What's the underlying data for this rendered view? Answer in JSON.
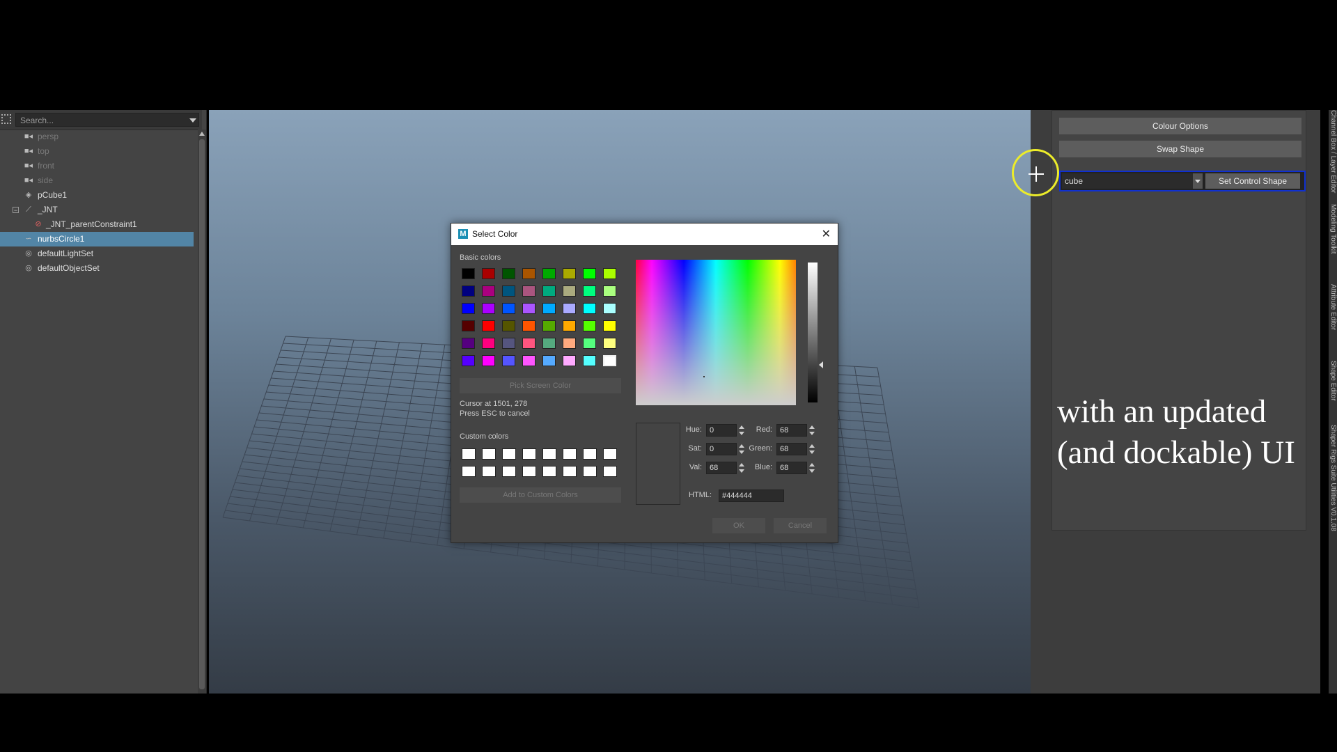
{
  "outliner": {
    "search_placeholder": "Search...",
    "items": [
      {
        "label": "persp",
        "icon": "camera-icon"
      },
      {
        "label": "top",
        "icon": "camera-icon"
      },
      {
        "label": "front",
        "icon": "camera-icon"
      },
      {
        "label": "side",
        "icon": "camera-icon"
      },
      {
        "label": "pCube1",
        "icon": "mesh-icon"
      },
      {
        "label": "_JNT",
        "icon": "joint-icon"
      },
      {
        "label": "_JNT_parentConstraint1",
        "icon": "constraint-icon"
      },
      {
        "label": "nurbsCircle1",
        "icon": "curve-icon"
      },
      {
        "label": "defaultLightSet",
        "icon": "set-icon"
      },
      {
        "label": "defaultObjectSet",
        "icon": "set-icon"
      }
    ]
  },
  "right_panel": {
    "colour_options_label": "Colour Options",
    "swap_shape_label": "Swap Shape",
    "shape_value": "cube",
    "set_control_shape_label": "Set Control Shape",
    "caption_line1": "with an updated",
    "caption_line2": "(and dockable) UI",
    "side_tabs": [
      "Channel Box / Layer Editor",
      "Modeling Toolkit",
      "Attribute Editor",
      "Shape Editor",
      "Shaper Rigs Suite Utilities V0.1.08"
    ]
  },
  "dialog": {
    "title": "Select Color",
    "app_icon_letter": "M",
    "basic_colors_label": "Basic colors",
    "basic_colors": [
      [
        "#000000",
        "#aa0000",
        "#005500",
        "#aa5500",
        "#00aa00",
        "#aaaa00",
        "#00ff00",
        "#aaff00"
      ],
      [
        "#00007f",
        "#aa007f",
        "#00557f",
        "#aa557f",
        "#00aa7f",
        "#aaaa7f",
        "#00ff7f",
        "#aaff7f"
      ],
      [
        "#0000ff",
        "#aa00ff",
        "#0055ff",
        "#aa55ff",
        "#00aaff",
        "#aaaaff",
        "#00ffff",
        "#aaffff"
      ],
      [
        "#550000",
        "#ff0000",
        "#555500",
        "#ff5500",
        "#55aa00",
        "#ffaa00",
        "#55ff00",
        "#ffff00"
      ],
      [
        "#55007f",
        "#ff007f",
        "#55557f",
        "#ff557f",
        "#55aa7f",
        "#ffaa7f",
        "#55ff7f",
        "#ffff7f"
      ],
      [
        "#5500ff",
        "#ff00ff",
        "#5555ff",
        "#ff55ff",
        "#55aaff",
        "#ffaaff",
        "#55ffff",
        "#ffffff"
      ]
    ],
    "pick_screen_color_label": "Pick Screen Color",
    "cursor_text": "Cursor at 1501, 278",
    "esc_text": "Press ESC to cancel",
    "custom_colors_label": "Custom colors",
    "add_custom_label": "Add to Custom Colors",
    "hue_label": "Hue:",
    "hue_value": "0",
    "sat_label": "Sat:",
    "sat_value": "0",
    "val_label": "Val:",
    "val_value": "68",
    "red_label": "Red:",
    "red_value": "68",
    "green_label": "Green:",
    "green_value": "68",
    "blue_label": "Blue:",
    "blue_value": "68",
    "html_label": "HTML:",
    "html_value": "#444444",
    "ok_label": "OK",
    "cancel_label": "Cancel"
  },
  "colors": {
    "selection": "#5285a6",
    "highlight_border": "#1030d0",
    "cursor_ring": "#ecec2a"
  }
}
